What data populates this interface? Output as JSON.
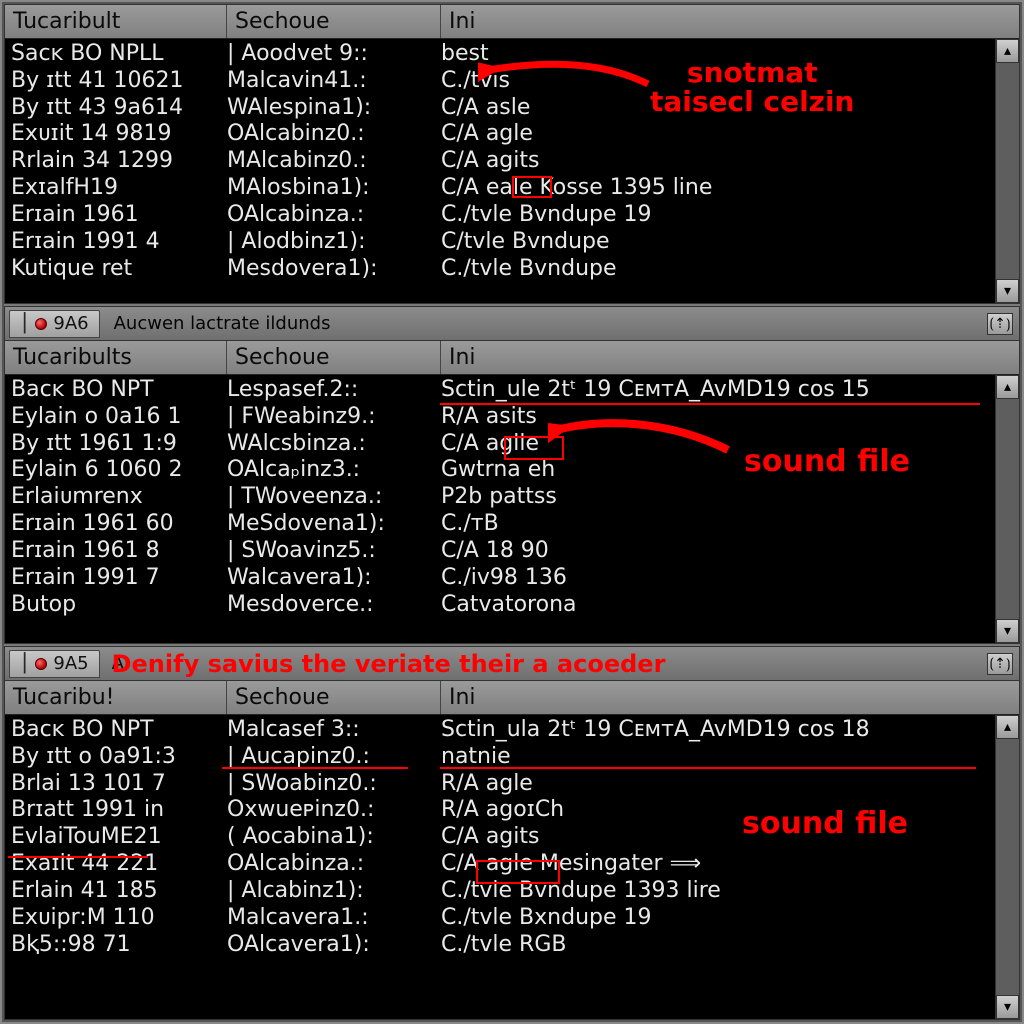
{
  "colors": {
    "anno": "#ff0000"
  },
  "columns": {
    "c1": "Tucaribult",
    "c2": "Sechoue",
    "c3": "Ini"
  },
  "columns2": {
    "c1": "Tucaribults",
    "c2": "Sechoue",
    "c3": "Ini"
  },
  "columns3": {
    "c1": "Tucaribu!",
    "c2": "Sechoue",
    "c3": "Ini"
  },
  "panel1": {
    "rows": [
      {
        "c1": "Sacᴋ BO NPLL",
        "c2": "| Aoodvet 9::",
        "c3": "best"
      },
      {
        "c1": "By ɪtt 41 10621",
        "c2": "Malcavin41.:",
        "c3": "C./tvis"
      },
      {
        "c1": "By ɪtt 43 9a614",
        "c2": "WAlespina1):",
        "c3": "C/A asle"
      },
      {
        "c1": "Exᴜɪit 14 9819",
        "c2": "OAlcabinz0.:",
        "c3": "C/A agle"
      },
      {
        "c1": "Rrlain 34 1299",
        "c2": "MAlcabinz0.:",
        "c3": "C/A agits"
      },
      {
        "c1": "ExɪalfH19",
        "c2": "MAlosbina1):",
        "c3": "C/A eale  Kosse 1395 line"
      },
      {
        "c1": "Erɪain 1961",
        "c2": "OAlcabinza.:",
        "c3": "C./tvle Bvndupe 19"
      },
      {
        "c1": "Erɪain 1991 4",
        "c2": "| Alodbinz1):",
        "c3": "C/tvle Bvndupe"
      },
      {
        "c1": "Kutique ret",
        "c2": "Mesdovera1):",
        "c3": "C./tvle Bvndupe"
      }
    ]
  },
  "panel2": {
    "tab_label": "9A6",
    "tab_title": "Aucwen lactrate ildunds",
    "rows": [
      {
        "c1": "Bacᴋ BO NPT",
        "c2": "Lespasef.2::",
        "c3": "Sctin_ule 2tᵗ 19 CᴇᴍᴛA_AvMD19 cos 15"
      },
      {
        "c1": "Eylain o 0a16 1",
        "c2": "| FWeabinz9.:",
        "c3": "R/A asits"
      },
      {
        "c1": "By ɪtt 1961 1:9",
        "c2": "WAlcsbinza.:",
        "c3": "C/A aglle"
      },
      {
        "c1": "Eylain 6 1060 2",
        "c2": "OAlcaₚinz3.:",
        "c3": "Gwtrna eh"
      },
      {
        "c1": "Erlaiᴜmrenx",
        "c2": "| TWoveenza.:",
        "c3": "P2b pattss"
      },
      {
        "c1": "Erɪain 1961 60",
        "c2": "MeSdovena1):",
        "c3": "C./ᴛB"
      },
      {
        "c1": "Erɪain 1961 8",
        "c2": "| SWoavinz5.:",
        "c3": "C/A 18 90"
      },
      {
        "c1": "Erɪain 1991 7",
        "c2": "Walcavera1):",
        "c3": "C./iv98 136"
      },
      {
        "c1": "Butop",
        "c2": "Mesdoverce.:",
        "c3": "Catvatorona"
      }
    ]
  },
  "panel3": {
    "tab_label": "9A5",
    "tab_title": "A",
    "overlay_text": "Denify savius the veriate their a acoeder",
    "rows": [
      {
        "c1": "Bacᴋ BO NPT",
        "c2": "Malcasef 3::",
        "c3": "Sctin_ula 2tᵗ 19 CᴇᴍᴛA_AvMD19 cos 18"
      },
      {
        "c1": "By ɪtt o 0a91:3",
        "c2": "| Aucapinz0.:",
        "c3": "natnie"
      },
      {
        "c1": "Brlai 13 101 7",
        "c2": "| SWoabinz0.:",
        "c3": "R/A agle"
      },
      {
        "c1": "Brɪatt 1991 in",
        "c2": "Oxwueᴘinz0.:",
        "c3": "R/A agoɪCh"
      },
      {
        "c1": "EvlaiTouME21",
        "c2": "( Aocabina1):",
        "c3": "C/A agits"
      },
      {
        "c1": "Exaɪit 44 221",
        "c2": "OAlcabinza.:",
        "c3": "C/A agle Mesingater  ⟹"
      },
      {
        "c1": "Erlain 41 185",
        "c2": "| Alcabinz1):",
        "c3": "C./tvle Bvndupe 1393 lire"
      },
      {
        "c1": "Exᴜipr:M 110",
        "c2": "Malcavera1.:",
        "c3": "C./tvle Bxndupe 19"
      },
      {
        "c1": "Bⱪ5::98  71",
        "c2": "OAlcavera1):",
        "c3": "C./tvle RGB"
      }
    ]
  },
  "annotations": {
    "a1_line1": "snotmat",
    "a1_line2": "taisecl celzin",
    "a2": "sound file",
    "a3": "sound file"
  }
}
